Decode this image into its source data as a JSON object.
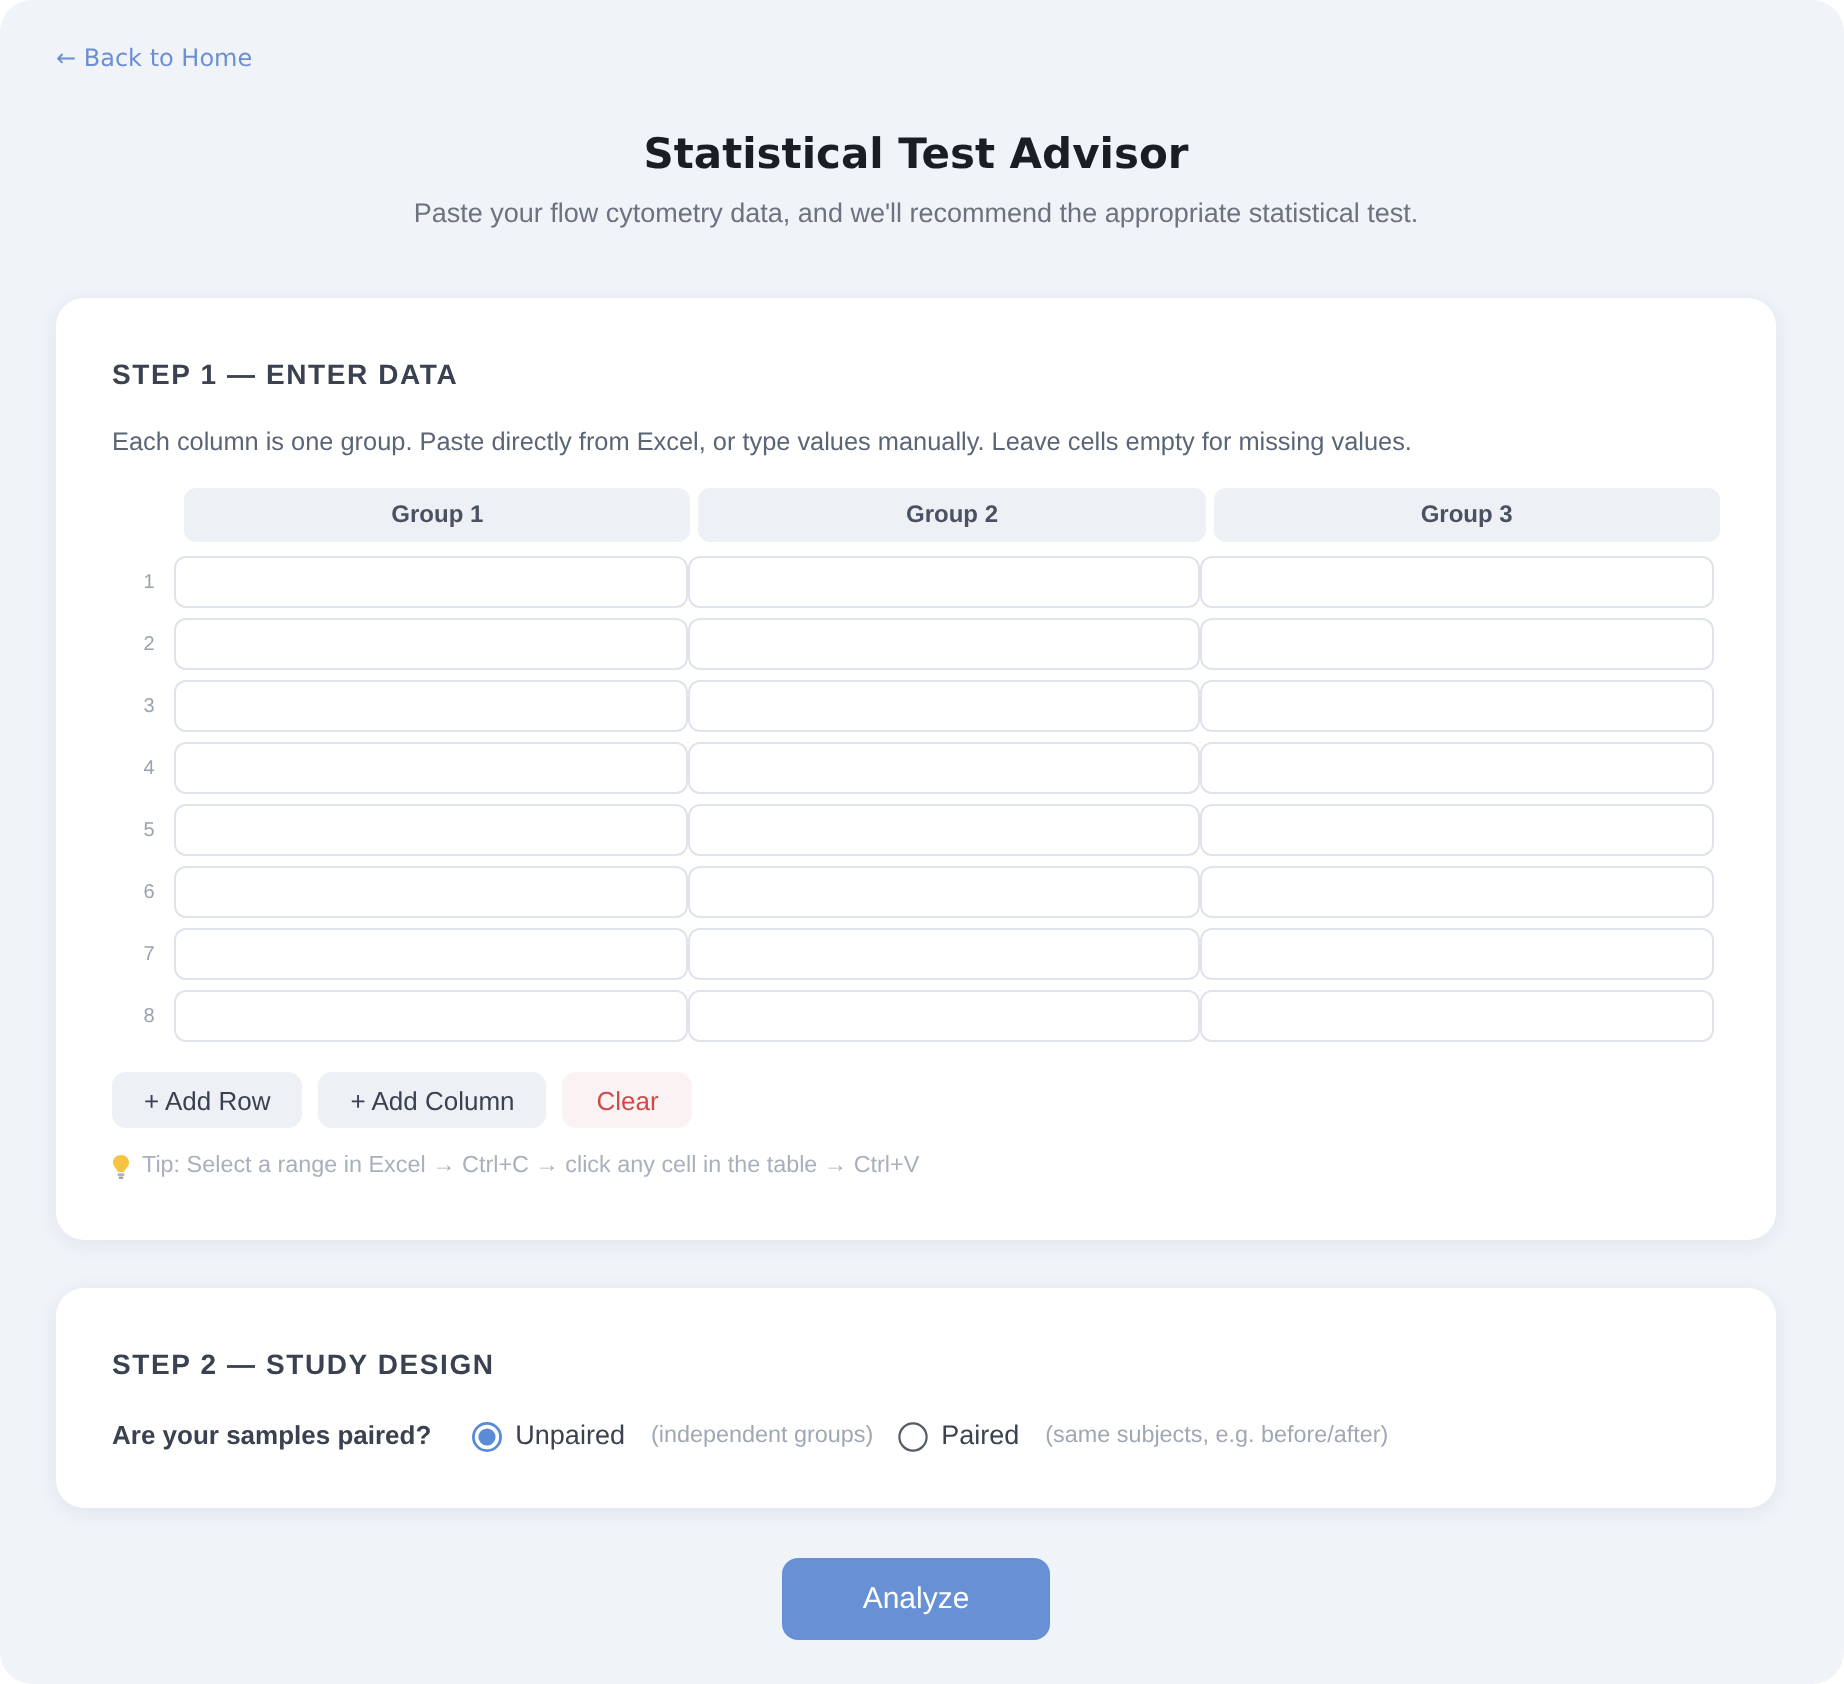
{
  "back_link": {
    "label": "← Back to Home"
  },
  "header": {
    "title": "Statistical Test Advisor",
    "subtitle": "Paste your flow cytometry data, and we'll recommend the appropriate statistical test."
  },
  "step1": {
    "heading": "STEP 1 — ENTER DATA",
    "description": "Each column is one group. Paste directly from Excel, or type values manually. Leave cells empty for missing values.",
    "table": {
      "columns": [
        "Group 1",
        "Group 2",
        "Group 3"
      ],
      "row_numbers": [
        "1",
        "2",
        "3",
        "4",
        "5",
        "6",
        "7",
        "8"
      ]
    },
    "buttons": [
      {
        "label": "+ Add Row",
        "kind": "neutral"
      },
      {
        "label": "+ Add Column",
        "kind": "neutral"
      },
      {
        "label": "Clear",
        "kind": "danger"
      }
    ],
    "tip": "Tip: Select a range in Excel → Ctrl+C → click any cell in the table → Ctrl+V"
  },
  "step2": {
    "heading": "STEP 2 — STUDY DESIGN",
    "question": "Are your samples paired?",
    "options": [
      {
        "label": "Unpaired",
        "hint": "(independent groups)",
        "selected": true
      },
      {
        "label": "Paired",
        "hint": "(same subjects, e.g. before/after)",
        "selected": false
      }
    ]
  },
  "analyze_button": {
    "label": "Analyze"
  }
}
